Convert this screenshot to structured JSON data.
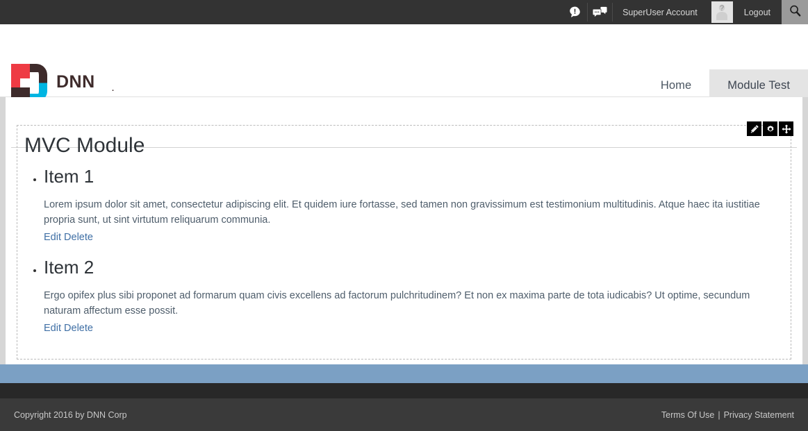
{
  "control_bar": {
    "notifications_icon": "notification-bubble-icon",
    "messages_icon": "message-bubble-icon",
    "account_label": "SuperUser Account",
    "avatar_icon": "user-avatar-placeholder-icon",
    "logout_label": "Logout",
    "search_icon": "search-icon"
  },
  "header": {
    "logo_alt": "DNN",
    "logo_wordmark": "DNN",
    "logo_dot": ".",
    "nav": [
      {
        "label": "Home",
        "active": false
      },
      {
        "label": "Module Test",
        "active": true
      }
    ]
  },
  "module": {
    "actions": [
      {
        "name": "edit-pencil-icon",
        "title": "Edit"
      },
      {
        "name": "gear-icon",
        "title": "Settings"
      },
      {
        "name": "move-arrows-icon",
        "title": "Move"
      }
    ],
    "title": "MVC Module",
    "items": [
      {
        "heading": "Item 1",
        "body": "Lorem ipsum dolor sit amet, consectetur adipiscing elit. Et quidem iure fortasse, sed tamen non gravissimum est testimonium multitudinis. Atque haec ita iustitiae propria sunt, ut sint virtutum reliquarum communia.",
        "edit_label": "Edit",
        "delete_label": "Delete"
      },
      {
        "heading": "Item 2",
        "body": "Ergo opifex plus sibi proponet ad formarum quam civis excellens ad factorum pulchritudinem? Et non ex maxima parte de tota iudicabis? Ut optime, secundum naturam affectum esse possit.",
        "edit_label": "Edit",
        "delete_label": "Delete"
      }
    ]
  },
  "footer": {
    "copyright": "Copyright 2016 by DNN Corp",
    "terms_label": "Terms Of Use",
    "separator": "|",
    "privacy_label": "Privacy Statement"
  },
  "colors": {
    "control_bar_bg": "#333333",
    "search_btn_bg": "#9a9a9a",
    "nav_active_bg": "#e4e4e4",
    "page_bg": "#d6d6d6",
    "footer_accent": "#7ba0c4",
    "footer_strip": "#282828",
    "footer_bg": "#3a3a3a",
    "link_blue": "#3f6fa5",
    "body_text": "#4e5d6b",
    "logo_red": "#ee3b44",
    "logo_cyan": "#00b5e2",
    "logo_dark": "#3e2b2b"
  }
}
